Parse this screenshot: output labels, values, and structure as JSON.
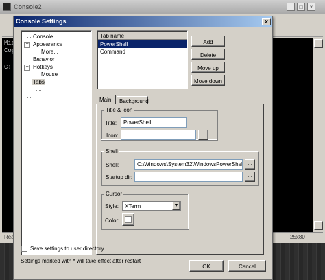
{
  "background_window": {
    "title": "Console2",
    "console_lines": [
      "Mic",
      "Cop",
      "",
      "C:"
    ],
    "status_left": "Rea",
    "status_size": "25x80"
  },
  "dialog": {
    "title": "Console Settings",
    "close_glyph": "x",
    "tree": {
      "items": [
        "Console",
        "Appearance",
        "More...",
        "Behavior",
        "Hotkeys",
        "Mouse",
        "Tabs"
      ],
      "selected": "Tabs"
    },
    "tabs_list": {
      "header": "Tab name",
      "rows": [
        "PowerShell",
        "Command"
      ],
      "selected": "PowerShell"
    },
    "buttons": {
      "add": "Add",
      "delete": "Delete",
      "move_up": "Move up",
      "move_down": "Move down",
      "ok": "OK",
      "cancel": "Cancel"
    },
    "subtabs": [
      "Main",
      "Background"
    ],
    "title_icon_group": {
      "legend": "Title & icon",
      "title_label": "Title:",
      "title_value": "PowerShell",
      "icon_label": "Icon:",
      "icon_value": "",
      "browse": "..."
    },
    "shell_group": {
      "legend": "Shell",
      "shell_label": "Shell:",
      "shell_value": "C:\\Windows\\System32\\WindowsPowerShell",
      "startup_label": "Startup dir:",
      "startup_value": "",
      "browse": "..."
    },
    "cursor_group": {
      "legend": "Cursor",
      "style_label": "Style:",
      "style_value": "XTerm",
      "color_label": "Color:",
      "color_value": "#ffffff"
    },
    "save_settings_label": "Save settings to user directory",
    "save_settings_checked": false,
    "footnote": "Settings marked with * will take effect after restart"
  },
  "colors": {
    "dialog_title_start": "#0a246a",
    "dialog_title_end": "#a6caf0",
    "selection": "#0a246a",
    "face": "#d4d0c8"
  }
}
